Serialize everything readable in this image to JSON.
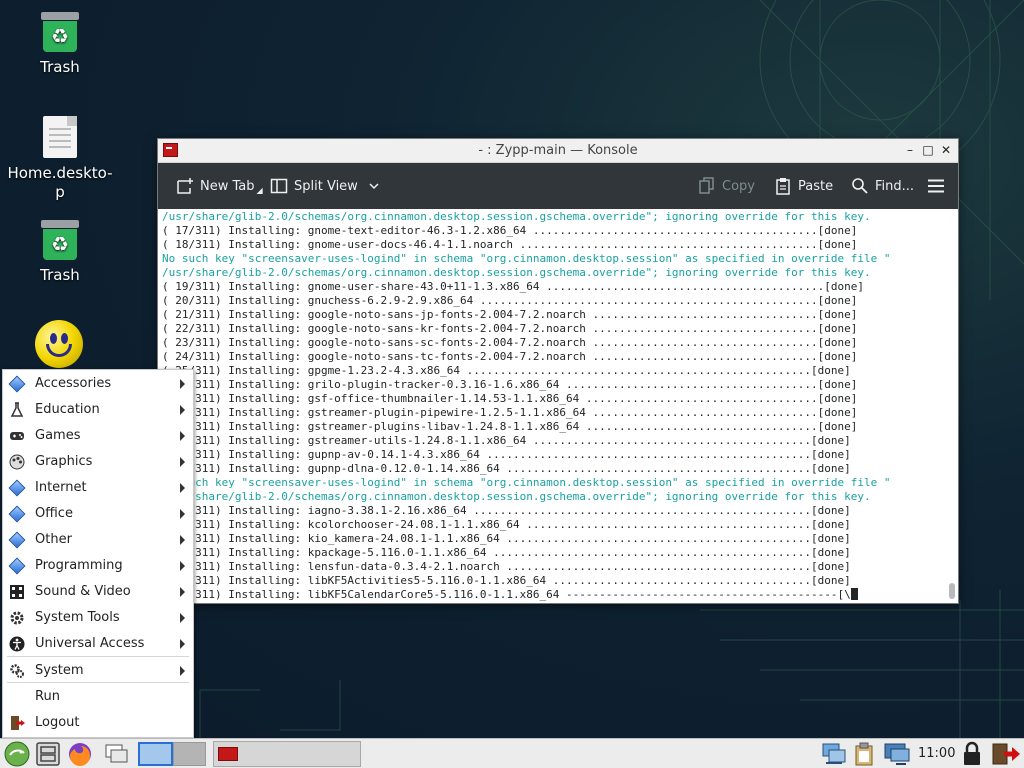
{
  "desktop": {
    "icons": [
      {
        "label": "Trash",
        "icon": "trash-icon"
      },
      {
        "label": "Home.deskto-p",
        "icon": "document-icon"
      },
      {
        "label": "Trash",
        "icon": "trash-icon"
      },
      {
        "label": "",
        "icon": "smiley-icon"
      }
    ]
  },
  "window": {
    "title": "- : Zypp-main — Konsole",
    "toolbar": {
      "new_tab": "New Tab",
      "split_view": "Split View",
      "copy": "Copy",
      "paste": "Paste",
      "find": "Find..."
    },
    "terminal_lines": [
      {
        "text": "/usr/share/glib-2.0/schemas/org.cinnamon.desktop.session.gschema.override\"; ignoring override for this key.",
        "warn": true
      },
      {
        "text": "( 17/311) Installing: gnome-text-editor-46.3-1.2.x86_64 ...........................................[done]",
        "warn": false
      },
      {
        "text": "( 18/311) Installing: gnome-user-docs-46.4-1.1.noarch .............................................[done]",
        "warn": false
      },
      {
        "text": "No such key \"screensaver-uses-logind\" in schema \"org.cinnamon.desktop.session\" as specified in override file \"",
        "warn": true
      },
      {
        "text": "/usr/share/glib-2.0/schemas/org.cinnamon.desktop.session.gschema.override\"; ignoring override for this key.",
        "warn": true
      },
      {
        "text": "( 19/311) Installing: gnome-user-share-43.0+11-1.3.x86_64 ..........................................[done]",
        "warn": false
      },
      {
        "text": "( 20/311) Installing: gnuchess-6.2.9-2.9.x86_64 ...................................................[done]",
        "warn": false
      },
      {
        "text": "( 21/311) Installing: google-noto-sans-jp-fonts-2.004-7.2.noarch ..................................[done]",
        "warn": false
      },
      {
        "text": "( 22/311) Installing: google-noto-sans-kr-fonts-2.004-7.2.noarch ..................................[done]",
        "warn": false
      },
      {
        "text": "( 23/311) Installing: google-noto-sans-sc-fonts-2.004-7.2.noarch ..................................[done]",
        "warn": false
      },
      {
        "text": "( 24/311) Installing: google-noto-sans-tc-fonts-2.004-7.2.noarch ..................................[done]",
        "warn": false
      },
      {
        "text": "( 25/311) Installing: gpgme-1.23.2-4.3.x86_64 ....................................................[done]",
        "warn": false
      },
      {
        "text": "( 26/311) Installing: grilo-plugin-tracker-0.3.16-1.6.x86_64 ......................................[done]",
        "warn": false
      },
      {
        "text": "( 27/311) Installing: gsf-office-thumbnailer-1.14.53-1.1.x86_64 ...................................[done]",
        "warn": false
      },
      {
        "text": "( 28/311) Installing: gstreamer-plugin-pipewire-1.2.5-1.1.x86_64 ..................................[done]",
        "warn": false
      },
      {
        "text": "( 29/311) Installing: gstreamer-plugins-libav-1.24.8-1.1.x86_64 ...................................[done]",
        "warn": false
      },
      {
        "text": "( 30/311) Installing: gstreamer-utils-1.24.8-1.1.x86_64 ..........................................[done]",
        "warn": false
      },
      {
        "text": "( 31/311) Installing: gupnp-av-0.14.1-4.3.x86_64 .................................................[done]",
        "warn": false
      },
      {
        "text": "( 32/311) Installing: gupnp-dlna-0.12.0-1.14.x86_64 ..............................................[done]",
        "warn": false
      },
      {
        "text": "No such key \"screensaver-uses-logind\" in schema \"org.cinnamon.desktop.session\" as specified in override file \"",
        "warn": true
      },
      {
        "text": "/usr/share/glib-2.0/schemas/org.cinnamon.desktop.session.gschema.override\"; ignoring override for this key.",
        "warn": true
      },
      {
        "text": "( 33/311) Installing: iagno-3.38.1-2.16.x86_64 ...................................................[done]",
        "warn": false
      },
      {
        "text": "( 34/311) Installing: kcolorchooser-24.08.1-1.1.x86_64 ...........................................[done]",
        "warn": false
      },
      {
        "text": "( 35/311) Installing: kio_kamera-24.08.1-1.1.x86_64 ..............................................[done]",
        "warn": false
      },
      {
        "text": "( 36/311) Installing: kpackage-5.116.0-1.1.x86_64 ................................................[done]",
        "warn": false
      },
      {
        "text": "( 37/311) Installing: lensfun-data-0.3.4-2.1.noarch ..............................................[done]",
        "warn": false
      },
      {
        "text": "( 38/311) Installing: libKF5Activities5-5.116.0-1.1.x86_64 .......................................[done]",
        "warn": false
      }
    ],
    "last_line": "( 39/311) Installing: libKF5CalendarCore5-5.116.0-1.1.x86_64 -----------------------------------------[\\"
  },
  "menu": {
    "items": [
      {
        "label": "Accessories",
        "icon": "accessories-icon",
        "submenu": true
      },
      {
        "label": "Education",
        "icon": "flask-icon",
        "submenu": true
      },
      {
        "label": "Games",
        "icon": "gamepad-icon",
        "submenu": true
      },
      {
        "label": "Graphics",
        "icon": "graphics-icon",
        "submenu": true
      },
      {
        "label": "Internet",
        "icon": "internet-icon",
        "submenu": true
      },
      {
        "label": "Office",
        "icon": "office-icon",
        "submenu": true
      },
      {
        "label": "Other",
        "icon": "other-icon",
        "submenu": true
      },
      {
        "label": "Programming",
        "icon": "programming-icon",
        "submenu": true
      },
      {
        "label": "Sound & Video",
        "icon": "music-icon",
        "submenu": true
      },
      {
        "label": "System Tools",
        "icon": "gear-icon",
        "submenu": true
      },
      {
        "label": "Universal Access",
        "icon": "accessibility-icon",
        "submenu": true
      },
      {
        "label": "System",
        "icon": "system-icon",
        "submenu": true
      },
      {
        "label": "Run",
        "icon": "",
        "submenu": false
      },
      {
        "label": "Logout",
        "icon": "logout-icon",
        "submenu": false
      }
    ]
  },
  "taskbar": {
    "clock": "11:00"
  }
}
